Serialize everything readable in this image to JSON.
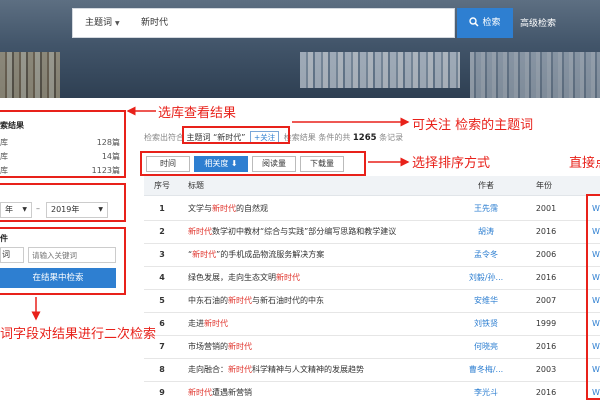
{
  "search": {
    "field": "主题词",
    "query": "新时代",
    "button": "检索",
    "advanced": "高级检索"
  },
  "sidebar": {
    "title": "索结果",
    "databases": [
      {
        "name": "库",
        "count": "128篇"
      },
      {
        "name": "库",
        "count": "14篇"
      },
      {
        "name": "库",
        "count": "1123篇"
      }
    ],
    "year_from": "年",
    "year_sep": "–",
    "year_to": "2019年",
    "secondary_title": "件",
    "secondary_field": "词",
    "keyword_placeholder": "请输入关键词",
    "search_in_results": "在结果中检索"
  },
  "summary": {
    "prefix": "检索出符合",
    "term_label": "主题词",
    "term_value": "“新时代”",
    "follow": "+关注",
    "mid": "检索结果 条件的共",
    "total": "1265",
    "suffix": "条记录"
  },
  "sort_tabs": [
    {
      "label": "时间",
      "active": false
    },
    {
      "label": "相关度 ⬇",
      "active": true
    },
    {
      "label": "阅读量",
      "active": false
    },
    {
      "label": "下载量",
      "active": false
    }
  ],
  "table": {
    "headers": [
      "序号",
      "标题",
      "作者",
      "年份"
    ],
    "rows": [
      {
        "no": "1",
        "title_before": "文学与",
        "title_hl": "新时代",
        "title_after": "的自然观",
        "author": "王先霈",
        "year": "2001",
        "fmt": "W"
      },
      {
        "no": "2",
        "title_before": "",
        "title_hl": "新时代",
        "title_after": "数学初中教材“综合与实践”部分编写思路和教学建议",
        "author": "胡涛",
        "year": "2016",
        "fmt": "W"
      },
      {
        "no": "3",
        "title_before": "“",
        "title_hl": "新时代",
        "title_after": "”的手机成品物流服务解决方案",
        "author": "孟令冬",
        "year": "2006",
        "fmt": "W"
      },
      {
        "no": "4",
        "title_before": "绿色发展，走向生态文明",
        "title_hl": "新时代",
        "title_after": "",
        "author": "刘毅/孙...",
        "year": "2016",
        "fmt": "W"
      },
      {
        "no": "5",
        "title_before": "中东石油的",
        "title_hl": "新时代",
        "title_after": "与新石油时代的中东",
        "author": "安维华",
        "year": "2007",
        "fmt": "W"
      },
      {
        "no": "6",
        "title_before": "走进",
        "title_hl": "新时代",
        "title_after": "",
        "author": "刘铁贤",
        "year": "1999",
        "fmt": "W"
      },
      {
        "no": "7",
        "title_before": "市场营销的",
        "title_hl": "新时代",
        "title_after": "",
        "author": "何晓亮",
        "year": "2016",
        "fmt": "W"
      },
      {
        "no": "8",
        "title_before": "走向融合：",
        "title_hl": "新时代",
        "title_after": "科学精神与人文精神的发展趋势",
        "author": "曹冬梅/...",
        "year": "2003",
        "fmt": "W"
      },
      {
        "no": "9",
        "title_before": "",
        "title_hl": "新时代",
        "title_after": "遭遇新营销",
        "author": "李光斗",
        "year": "2016",
        "fmt": "W"
      }
    ]
  },
  "annotations": {
    "select_db": "选库查看结果",
    "follow_topic": "可关注 检索的主题词",
    "sort": "选择排序方式",
    "direct": "直接点",
    "secondary": "词字段对结果进行二次检索"
  },
  "colors": {
    "accent": "#2e7fd1",
    "highlight": "#e0322a",
    "annotation": "#e8211a"
  }
}
